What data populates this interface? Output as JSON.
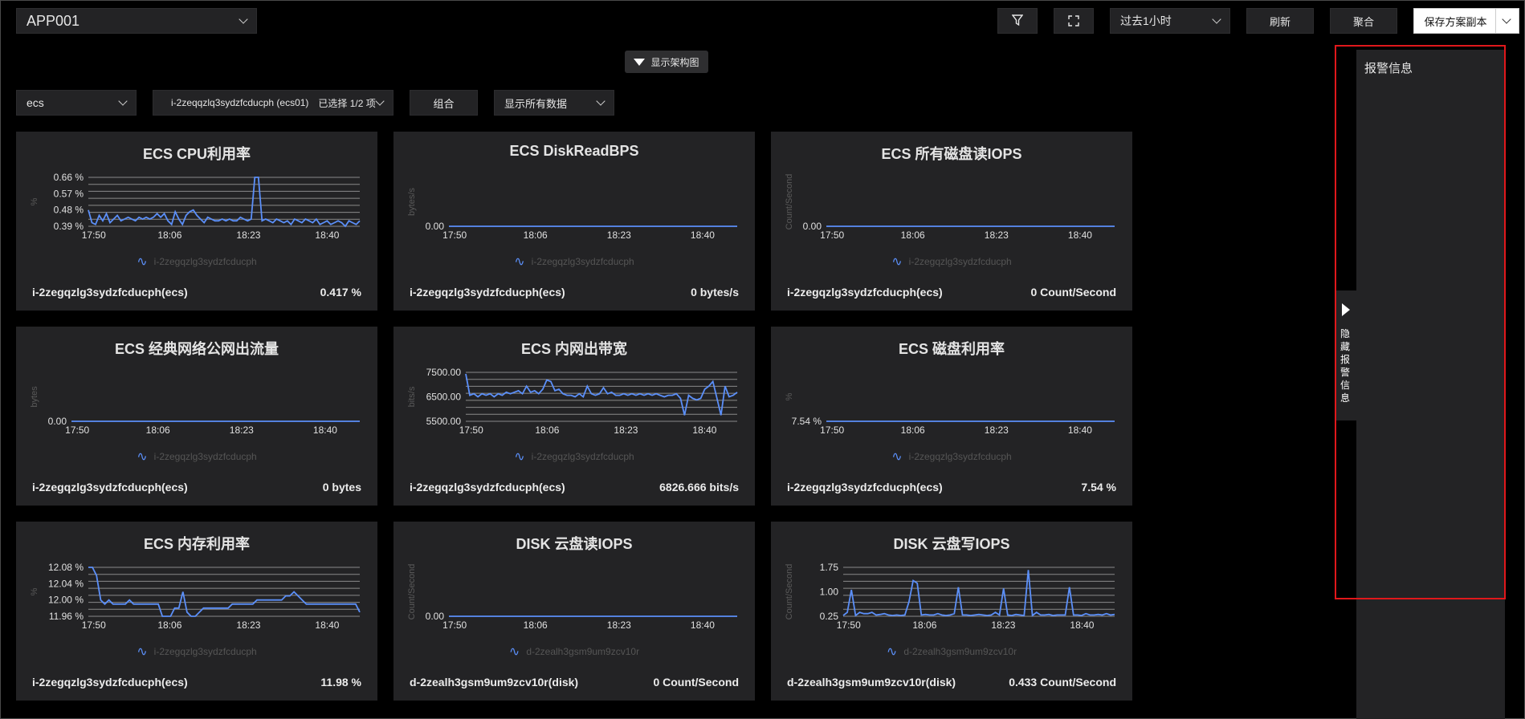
{
  "app_select": {
    "value": "APP001"
  },
  "toolbar": {
    "time_range": "过去1小时",
    "refresh": "刷新",
    "aggregate": "聚合",
    "save": "保存方案副本"
  },
  "arch_toggle": {
    "label": "显示架构图"
  },
  "filters": {
    "resource_type": "ecs",
    "instance": "i-2zeqqzlq3sydzfcducph (ecs01)",
    "instance_selected": "已选择 1/2 项",
    "combine": "组合",
    "data_scope": "显示所有数据"
  },
  "alarm": {
    "title": "报警信息",
    "hide_label": "隐藏报警信息"
  },
  "colors": {
    "series": "#5b8ff9",
    "panel": "#232325",
    "highlight": "#e0181b"
  },
  "cards": [
    {
      "title": "ECS CPU利用率",
      "legend": "i-2zegqzlg3sydzfcducph",
      "instance": "i-2zegqzlg3sydzfcducph(ecs)",
      "value": "0.417 %",
      "chart_data": {
        "type": "line",
        "ylabel": "%",
        "yticks": [
          "0.66 %",
          "0.57 %",
          "0.48 %",
          "0.39 %"
        ],
        "ylim": [
          0.39,
          0.66
        ],
        "xticks": [
          "17:50",
          "18:06",
          "18:23",
          "18:40"
        ],
        "series": [
          {
            "values": [
              0.48,
              0.41,
              0.4,
              0.45,
              0.42,
              0.46,
              0.41,
              0.43,
              0.45,
              0.42,
              0.43,
              0.44,
              0.43,
              0.42,
              0.44,
              0.43,
              0.44,
              0.43,
              0.44,
              0.46,
              0.44,
              0.46,
              0.42,
              0.4,
              0.47,
              0.43,
              0.4,
              0.45,
              0.47,
              0.48,
              0.45,
              0.43,
              0.41,
              0.44,
              0.43,
              0.42,
              0.42,
              0.43,
              0.42,
              0.43,
              0.42,
              0.42,
              0.44,
              0.43,
              0.42,
              0.43,
              0.66,
              0.66,
              0.42,
              0.43,
              0.42,
              0.41,
              0.43,
              0.42,
              0.41,
              0.42,
              0.4,
              0.43,
              0.42,
              0.41,
              0.43,
              0.42,
              0.41,
              0.43,
              0.4,
              0.41,
              0.42,
              0.4,
              0.41,
              0.42,
              0.41,
              0.39,
              0.42,
              0.41,
              0.4,
              0.42
            ]
          }
        ]
      }
    },
    {
      "title": "ECS DiskReadBPS",
      "legend": "i-2zegqzlg3sydzfcducph",
      "instance": "i-2zegqzlg3sydzfcducph(ecs)",
      "value": "0 bytes/s",
      "chart_data": {
        "type": "line",
        "ylabel": "bytes/s",
        "yticks": [
          "0.00"
        ],
        "ylim": [
          0,
          1
        ],
        "xticks": [
          "17:50",
          "18:06",
          "18:23",
          "18:40"
        ],
        "series": [
          {
            "values": [
              0,
              0
            ]
          }
        ]
      }
    },
    {
      "title": "ECS 所有磁盘读IOPS",
      "legend": "i-2zegqzlg3sydzfcducph",
      "instance": "i-2zegqzlg3sydzfcducph(ecs)",
      "value": "0 Count/Second",
      "chart_data": {
        "type": "line",
        "ylabel": "Count/Second",
        "yticks": [
          "0.00"
        ],
        "ylim": [
          0,
          1
        ],
        "xticks": [
          "17:50",
          "18:06",
          "18:23",
          "18:40"
        ],
        "series": [
          {
            "values": [
              0,
              0
            ]
          }
        ]
      }
    },
    {
      "title": "ECS 经典网络公网出流量",
      "legend": "i-2zegqzlg3sydzfcducph",
      "instance": "i-2zegqzlg3sydzfcducph(ecs)",
      "value": "0 bytes",
      "chart_data": {
        "type": "line",
        "ylabel": "bytes",
        "yticks": [
          "0.00"
        ],
        "ylim": [
          0,
          1
        ],
        "xticks": [
          "17:50",
          "18:06",
          "18:23",
          "18:40"
        ],
        "series": [
          {
            "values": [
              0,
              0
            ]
          }
        ]
      }
    },
    {
      "title": "ECS 内网出带宽",
      "legend": "i-2zegqzlg3sydzfcducph",
      "instance": "i-2zegqzlg3sydzfcducph(ecs)",
      "value": "6826.666 bits/s",
      "chart_data": {
        "type": "line",
        "ylabel": "bits/s",
        "yticks": [
          "7500.00",
          "6500.00",
          "5500.00"
        ],
        "ylim": [
          5000,
          8200
        ],
        "xticks": [
          "17:50",
          "18:06",
          "18:23",
          "18:40"
        ],
        "series": [
          {
            "values": [
              8100,
              6700,
              6800,
              6600,
              6800,
              6700,
              6800,
              6600,
              6800,
              6700,
              6900,
              6800,
              6900,
              7000,
              6800,
              7300,
              6900,
              7000,
              6800,
              7100,
              7700,
              7600,
              7000,
              7100,
              6800,
              6700,
              6700,
              6600,
              6800,
              6600,
              7300,
              6800,
              6700,
              6800,
              7200,
              6800,
              6900,
              6700,
              6700,
              6800,
              6700,
              6800,
              6700,
              6800,
              6700,
              6800,
              6700,
              6800,
              6700,
              6600,
              6700,
              6700,
              6800,
              6500,
              5400,
              6700,
              6500,
              6400,
              6500,
              7100,
              7300,
              7600,
              6500,
              5400,
              7300,
              6600,
              6700,
              6900
            ]
          }
        ]
      }
    },
    {
      "title": "ECS 磁盘利用率",
      "legend": "i-2zegqzlg3sydzfcducph",
      "instance": "i-2zegqzlg3sydzfcducph(ecs)",
      "value": "7.54 %",
      "chart_data": {
        "type": "line",
        "ylabel": "%",
        "yticks": [
          "7.54 %"
        ],
        "ylim": [
          7.54,
          7.6
        ],
        "xticks": [
          "17:50",
          "18:06",
          "18:23",
          "18:40"
        ],
        "series": [
          {
            "values": [
              7.54,
              7.54
            ]
          }
        ]
      }
    },
    {
      "title": "ECS 内存利用率",
      "legend": "i-2zegqzlg3sydzfcducph",
      "instance": "i-2zegqzlg3sydzfcducph(ecs)",
      "value": "11.98 %",
      "chart_data": {
        "type": "line",
        "ylabel": "%",
        "yticks": [
          "12.08 %",
          "12.04 %",
          "12.00 %",
          "11.96 %"
        ],
        "ylim": [
          11.96,
          12.08
        ],
        "xticks": [
          "17:50",
          "18:06",
          "18:23",
          "18:40"
        ],
        "series": [
          {
            "values": [
              12.08,
              12.08,
              12.06,
              12.0,
              11.99,
              12.0,
              11.99,
              11.99,
              11.99,
              11.99,
              12.0,
              11.99,
              11.99,
              11.99,
              11.99,
              11.99,
              11.99,
              11.99,
              11.96,
              11.96,
              11.96,
              11.98,
              11.98,
              12.02,
              11.97,
              11.96,
              11.96,
              11.97,
              11.98,
              11.98,
              11.98,
              11.98,
              11.98,
              11.98,
              11.98,
              11.99,
              11.99,
              11.99,
              11.99,
              11.99,
              11.99,
              12.0,
              12.0,
              12.0,
              12.0,
              12.0,
              12.0,
              12.0,
              12.01,
              12.01,
              12.02,
              12.01,
              12.0,
              11.99,
              11.99,
              11.99,
              11.99,
              11.99,
              11.99,
              11.99,
              11.99,
              11.99,
              11.99,
              11.99,
              11.99,
              11.99,
              11.97
            ]
          }
        ]
      }
    },
    {
      "title": "DISK 云盘读IOPS",
      "legend": "d-2zealh3gsm9um9zcv10r",
      "instance": "d-2zealh3gsm9um9zcv10r(disk)",
      "value": "0 Count/Second",
      "chart_data": {
        "type": "line",
        "ylabel": "Count/Second",
        "yticks": [
          "0.00"
        ],
        "ylim": [
          0,
          1
        ],
        "xticks": [
          "17:50",
          "18:06",
          "18:23",
          "18:40"
        ],
        "series": [
          {
            "values": [
              0,
              0
            ]
          }
        ]
      }
    },
    {
      "title": "DISK 云盘写IOPS",
      "legend": "d-2zealh3gsm9um9zcv10r",
      "instance": "d-2zealh3gsm9um9zcv10r(disk)",
      "value": "0.433 Count/Second",
      "chart_data": {
        "type": "line",
        "ylabel": "Count/Second",
        "yticks": [
          "1.75",
          "1.00",
          "0.25"
        ],
        "ylim": [
          0.25,
          2.1
        ],
        "xticks": [
          "17:50",
          "18:06",
          "18:23",
          "18:40"
        ],
        "series": [
          {
            "values": [
              0.28,
              0.4,
              1.25,
              0.28,
              0.4,
              0.35,
              0.35,
              0.4,
              0.3,
              0.32,
              0.35,
              0.3,
              0.28,
              0.3,
              0.28,
              0.3,
              0.8,
              1.6,
              1.5,
              0.3,
              0.32,
              0.3,
              0.3,
              0.35,
              0.3,
              0.28,
              0.3,
              0.35,
              1.35,
              0.3,
              0.3,
              0.28,
              0.3,
              0.32,
              0.3,
              0.28,
              0.3,
              0.4,
              0.3,
              1.3,
              0.3,
              0.28,
              0.32,
              0.3,
              0.28,
              2.0,
              0.28,
              0.4,
              0.3,
              0.3,
              0.32,
              0.28,
              0.3,
              0.3,
              0.3,
              1.35,
              0.3,
              0.3,
              0.28,
              0.35,
              0.3,
              0.3,
              0.32,
              0.3,
              0.35,
              0.3,
              0.32
            ]
          }
        ]
      }
    }
  ]
}
